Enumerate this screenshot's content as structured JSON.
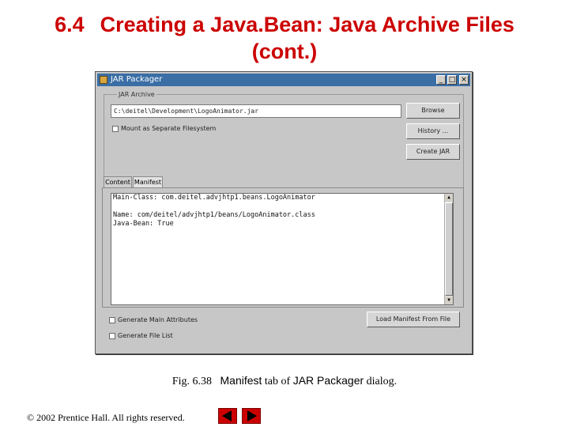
{
  "slide": {
    "title_num": "6.4",
    "title_line1": "Creating a Java.Bean: Java Archive Files",
    "title_line2": "(cont.)"
  },
  "window": {
    "title": "JAR Packager",
    "min_label": "_",
    "max_label": "□",
    "close_label": "×",
    "group_label": "JAR Archive",
    "path_value": "C:\\deitel\\Development\\LogoAnimator.jar",
    "browse_label": "Browse",
    "history_label": "History ...",
    "create_jar_label": "Create JAR",
    "mount_checkbox_label": "Mount as Separate Filesystem",
    "tabs": [
      {
        "label": "Content"
      },
      {
        "label": "Manifest"
      }
    ],
    "manifest_lines": [
      "Main-Class: com.deitel.advjhtp1.beans.LogoAnimator",
      "",
      "Name: com/deitel/advjhtp1/beans/LogoAnimator.class",
      "Java-Bean: True"
    ],
    "scroll_up": "▲",
    "scroll_down": "▼",
    "generate_main_label": "Generate Main Attributes",
    "generate_file_list_label": "Generate File List",
    "load_manifest_label": "Load Manifest From File"
  },
  "caption": {
    "fig": "Fig. 6.38",
    "tab_name": "Manifest",
    "middle": "tab of",
    "dialog_name": "JAR Packager",
    "end": "dialog."
  },
  "footer": {
    "copyright": "© 2002 Prentice Hall.  All rights reserved."
  },
  "colors": {
    "title_red": "#cc0000",
    "window_gray": "#c7c7c7",
    "titlebar_blue": "#3a6ea5"
  },
  "icons": [
    "prev-arrow-icon",
    "next-arrow-icon",
    "app-icon"
  ]
}
